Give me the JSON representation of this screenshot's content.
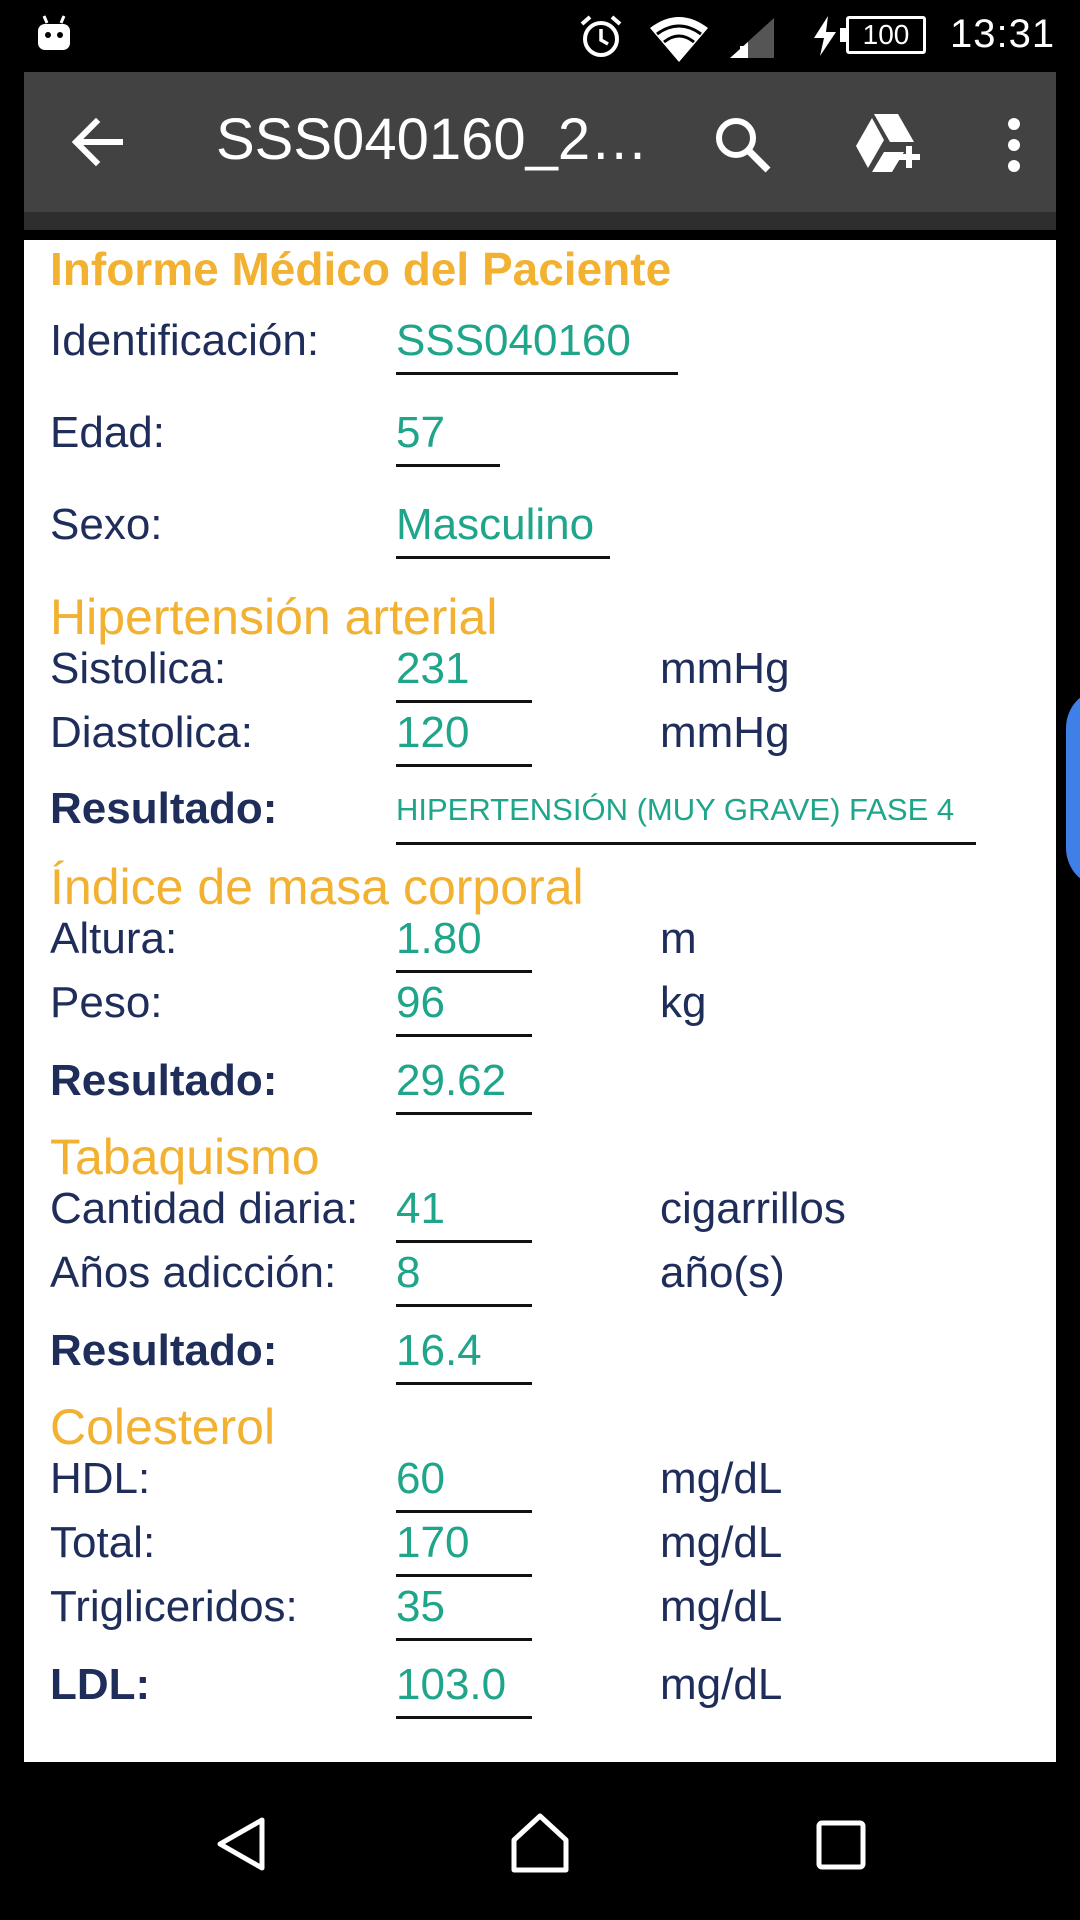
{
  "status_bar": {
    "time": "13:31",
    "battery": "100",
    "icons": [
      "android-debug-icon",
      "alarm-icon",
      "wifi-icon",
      "signal-icon",
      "charging-icon",
      "battery-icon"
    ]
  },
  "app_bar": {
    "title": "SSS040160_2…",
    "icons": [
      "back-arrow-icon",
      "search-icon",
      "drive-add-icon",
      "overflow-menu-icon"
    ]
  },
  "report": {
    "title": "Informe Médico del Paciente",
    "patient": {
      "id_label": "Identificación:",
      "id_value": "SSS040160",
      "age_label": "Edad:",
      "age_value": "57",
      "sex_label": "Sexo:",
      "sex_value": "Masculino"
    },
    "hypertension": {
      "heading": "Hipertensión arterial",
      "systolic_label": "Sistolica:",
      "systolic_value": "231",
      "systolic_unit": "mmHg",
      "diastolic_label": "Diastolica:",
      "diastolic_value": "120",
      "diastolic_unit": "mmHg",
      "result_label": "Resultado:",
      "result_value": "HIPERTENSIÓN (MUY GRAVE) FASE 4"
    },
    "bmi": {
      "heading": "Índice de masa corporal",
      "height_label": "Altura:",
      "height_value": "1.80",
      "height_unit": "m",
      "weight_label": "Peso:",
      "weight_value": "96",
      "weight_unit": "kg",
      "result_label": "Resultado:",
      "result_value": "29.62"
    },
    "smoking": {
      "heading": "Tabaquismo",
      "daily_label": "Cantidad diaria:",
      "daily_value": "41",
      "daily_unit": "cigarrillos",
      "years_label": "Años adicción:",
      "years_value": "8",
      "years_unit": "año(s)",
      "result_label": "Resultado:",
      "result_value": "16.4"
    },
    "cholesterol": {
      "heading": "Colesterol",
      "hdl_label": "HDL:",
      "hdl_value": "60",
      "hdl_unit": "mg/dL",
      "total_label": "Total:",
      "total_value": "170",
      "total_unit": "mg/dL",
      "trig_label": "Trigliceridos:",
      "trig_value": "35",
      "trig_unit": "mg/dL",
      "ldl_label": "LDL:",
      "ldl_value": "103.0",
      "ldl_unit": "mg/dL"
    }
  },
  "colors": {
    "accent": "#F2B130",
    "value": "#1ea58a",
    "label": "#1f2d5a",
    "toolbar": "#424242"
  }
}
